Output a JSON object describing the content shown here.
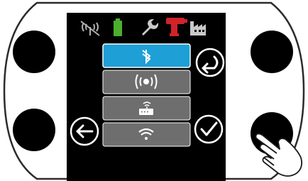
{
  "device": {
    "status_icons": [
      {
        "name": "no-signal-icon",
        "color": "#b0b0b0"
      },
      {
        "name": "battery-icon",
        "color": "#4caf2f"
      },
      {
        "name": "wrench-icon",
        "color": "#c9c9c9"
      },
      {
        "name": "power-tool-icon",
        "color": "#d0232a"
      },
      {
        "name": "factory-icon",
        "color": "#c9c9c9"
      }
    ],
    "menu": {
      "items": [
        {
          "name": "bluetooth",
          "icon": "bluetooth-icon",
          "selected": true
        },
        {
          "name": "radio-signal",
          "icon": "radio-signal-icon",
          "selected": false
        },
        {
          "name": "router",
          "icon": "router-icon",
          "selected": false
        },
        {
          "name": "wifi",
          "icon": "wifi-icon",
          "selected": false
        }
      ]
    },
    "buttons": {
      "back": {
        "icon": "return-arrow-icon"
      },
      "left": {
        "icon": "left-arrow-icon"
      },
      "confirm": {
        "icon": "checkmark-icon"
      }
    },
    "colors": {
      "screen": "#000000",
      "selected_item": "#1e9fd6",
      "menu_item": "#6e6e6e",
      "icon_white": "#ffffff"
    }
  }
}
